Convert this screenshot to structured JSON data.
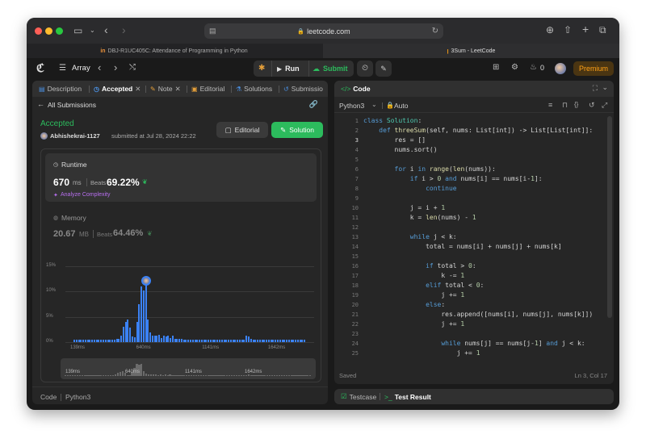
{
  "browser": {
    "url": "leetcode.com",
    "tabs": [
      {
        "label": "DBJ-R1UC405C: Attendance of Programming in Python"
      },
      {
        "label": "3Sum - LeetCode"
      }
    ]
  },
  "topbar": {
    "problem_list": "Array",
    "run": "Run",
    "submit": "Submit",
    "streak": "0",
    "premium": "Premium"
  },
  "left": {
    "tabs": [
      "Description",
      "Accepted",
      "Note",
      "Editorial",
      "Solutions",
      "Submissio"
    ],
    "back": "All Submissions",
    "status": "Accepted",
    "user": "Abhishekrai-1127",
    "submitted": "submitted at Jul 28, 2024 22:22",
    "editorial_btn": "Editorial",
    "solution_btn": "Solution",
    "runtime_label": "Runtime",
    "runtime_value": "670",
    "runtime_unit": "ms",
    "beats_label": "Beats",
    "runtime_beats": "69.22%",
    "analyze": "Analyze Complexity",
    "memory_label": "Memory",
    "memory_value": "20.67",
    "memory_unit": "MB",
    "memory_beats": "64.46%",
    "footer_code": "Code",
    "footer_lang": "Python3"
  },
  "chart_data": {
    "type": "bar",
    "ylim": [
      0,
      15
    ],
    "yticks": [
      "15%",
      "10%",
      "5%",
      "0%"
    ],
    "xticks": [
      "139ms",
      "640ms",
      "1141ms",
      "1642ms"
    ],
    "mini_xticks": [
      "139ms",
      "640ms",
      "1141ms",
      "1642ms"
    ],
    "values": [
      0.4,
      0.4,
      0.4,
      0.4,
      0.4,
      0.4,
      0.4,
      0.4,
      0.4,
      0.4,
      0.4,
      0.4,
      0.4,
      0.4,
      0.4,
      0.4,
      0.4,
      0.5,
      0.5,
      0.6,
      0.7,
      1.2,
      3.0,
      4.0,
      4.4,
      2.8,
      1.1,
      0.9,
      4.0,
      7.5,
      11.0,
      10.2,
      11.5,
      4.4,
      1.9,
      1.2,
      1.3,
      1.2,
      1.5,
      0.8,
      1.3,
      1.1,
      1.3,
      0.8,
      1.3,
      0.6,
      0.7,
      0.6,
      0.6,
      0.5,
      0.5,
      0.5,
      0.4,
      0.5,
      0.4,
      0.4,
      0.4,
      0.4,
      0.4,
      0.4,
      0.4,
      0.4,
      0.4,
      0.4,
      0.4,
      0.4,
      0.4,
      0.4,
      0.4,
      0.4,
      0.4,
      0.4,
      0.4,
      0.4,
      0.4,
      0.4,
      0.5,
      1.3,
      1.1,
      0.6,
      0.4,
      0.4,
      0.4,
      0.4,
      0.4,
      0.4,
      0.4,
      0.4,
      0.4,
      0.4,
      0.4,
      0.4,
      0.4,
      0.4,
      0.4,
      0.4,
      0.4,
      0.4,
      0.4,
      0.4,
      0.4,
      0.4,
      0.4,
      0.4
    ]
  },
  "code": {
    "title": "Code",
    "language": "Python3",
    "mode": "Auto",
    "saved": "Saved",
    "cursor": "Ln 3, Col 17",
    "lines": [
      [
        [
          "kw",
          "class "
        ],
        [
          "cls",
          "Solution"
        ],
        [
          "tx",
          ":"
        ]
      ],
      [
        [
          "tx",
          "    "
        ],
        [
          "kw",
          "def "
        ],
        [
          "fn",
          "threeSum"
        ],
        [
          "tx",
          "(self, nums: List[int]) -> List[List[int]]:"
        ]
      ],
      [
        [
          "tx",
          "        res = []"
        ]
      ],
      [
        [
          "tx",
          "        nums.sort()"
        ]
      ],
      [
        [
          "tx",
          ""
        ]
      ],
      [
        [
          "tx",
          "        "
        ],
        [
          "kw",
          "for "
        ],
        [
          "tx",
          "i "
        ],
        [
          "kw",
          "in "
        ],
        [
          "fn",
          "range"
        ],
        [
          "tx",
          "("
        ],
        [
          "fn",
          "len"
        ],
        [
          "tx",
          "(nums)):"
        ]
      ],
      [
        [
          "tx",
          "            "
        ],
        [
          "kw",
          "if "
        ],
        [
          "tx",
          "i > "
        ],
        [
          "num",
          "0"
        ],
        [
          "kw",
          " and "
        ],
        [
          "tx",
          "nums[i] == nums[i-"
        ],
        [
          "num",
          "1"
        ],
        [
          "tx",
          "]:"
        ]
      ],
      [
        [
          "tx",
          "                "
        ],
        [
          "kw",
          "continue"
        ]
      ],
      [
        [
          "tx",
          ""
        ]
      ],
      [
        [
          "tx",
          "            j = i + "
        ],
        [
          "num",
          "1"
        ]
      ],
      [
        [
          "tx",
          "            k = "
        ],
        [
          "fn",
          "len"
        ],
        [
          "tx",
          "(nums) - "
        ],
        [
          "num",
          "1"
        ]
      ],
      [
        [
          "tx",
          ""
        ]
      ],
      [
        [
          "tx",
          "            "
        ],
        [
          "kw",
          "while "
        ],
        [
          "tx",
          "j < k:"
        ]
      ],
      [
        [
          "tx",
          "                total = nums[i] + nums[j] + nums[k]"
        ]
      ],
      [
        [
          "tx",
          ""
        ]
      ],
      [
        [
          "tx",
          "                "
        ],
        [
          "kw",
          "if "
        ],
        [
          "tx",
          "total > "
        ],
        [
          "num",
          "0"
        ],
        [
          "tx",
          ":"
        ]
      ],
      [
        [
          "tx",
          "                    k -= "
        ],
        [
          "num",
          "1"
        ]
      ],
      [
        [
          "tx",
          "                "
        ],
        [
          "kw",
          "elif "
        ],
        [
          "tx",
          "total < "
        ],
        [
          "num",
          "0"
        ],
        [
          "tx",
          ":"
        ]
      ],
      [
        [
          "tx",
          "                    j += "
        ],
        [
          "num",
          "1"
        ]
      ],
      [
        [
          "tx",
          "                "
        ],
        [
          "kw",
          "else"
        ],
        [
          "tx",
          ":"
        ]
      ],
      [
        [
          "tx",
          "                    res.append([nums[i], nums[j], nums[k]])"
        ]
      ],
      [
        [
          "tx",
          "                    j += "
        ],
        [
          "num",
          "1"
        ]
      ],
      [
        [
          "tx",
          ""
        ]
      ],
      [
        [
          "tx",
          "                    "
        ],
        [
          "kw",
          "while "
        ],
        [
          "tx",
          "nums[j] == nums[j-"
        ],
        [
          "num",
          "1"
        ],
        [
          "tx",
          "] "
        ],
        [
          "kw",
          "and "
        ],
        [
          "tx",
          "j < k:"
        ]
      ],
      [
        [
          "tx",
          "                        j += "
        ],
        [
          "num",
          "1"
        ]
      ]
    ]
  },
  "bottom": {
    "testcase": "Testcase",
    "result": "Test Result"
  },
  "colors": {
    "accepted": "#2cbb5d",
    "bar": "#3b82f6",
    "premium": "#ffa116"
  }
}
